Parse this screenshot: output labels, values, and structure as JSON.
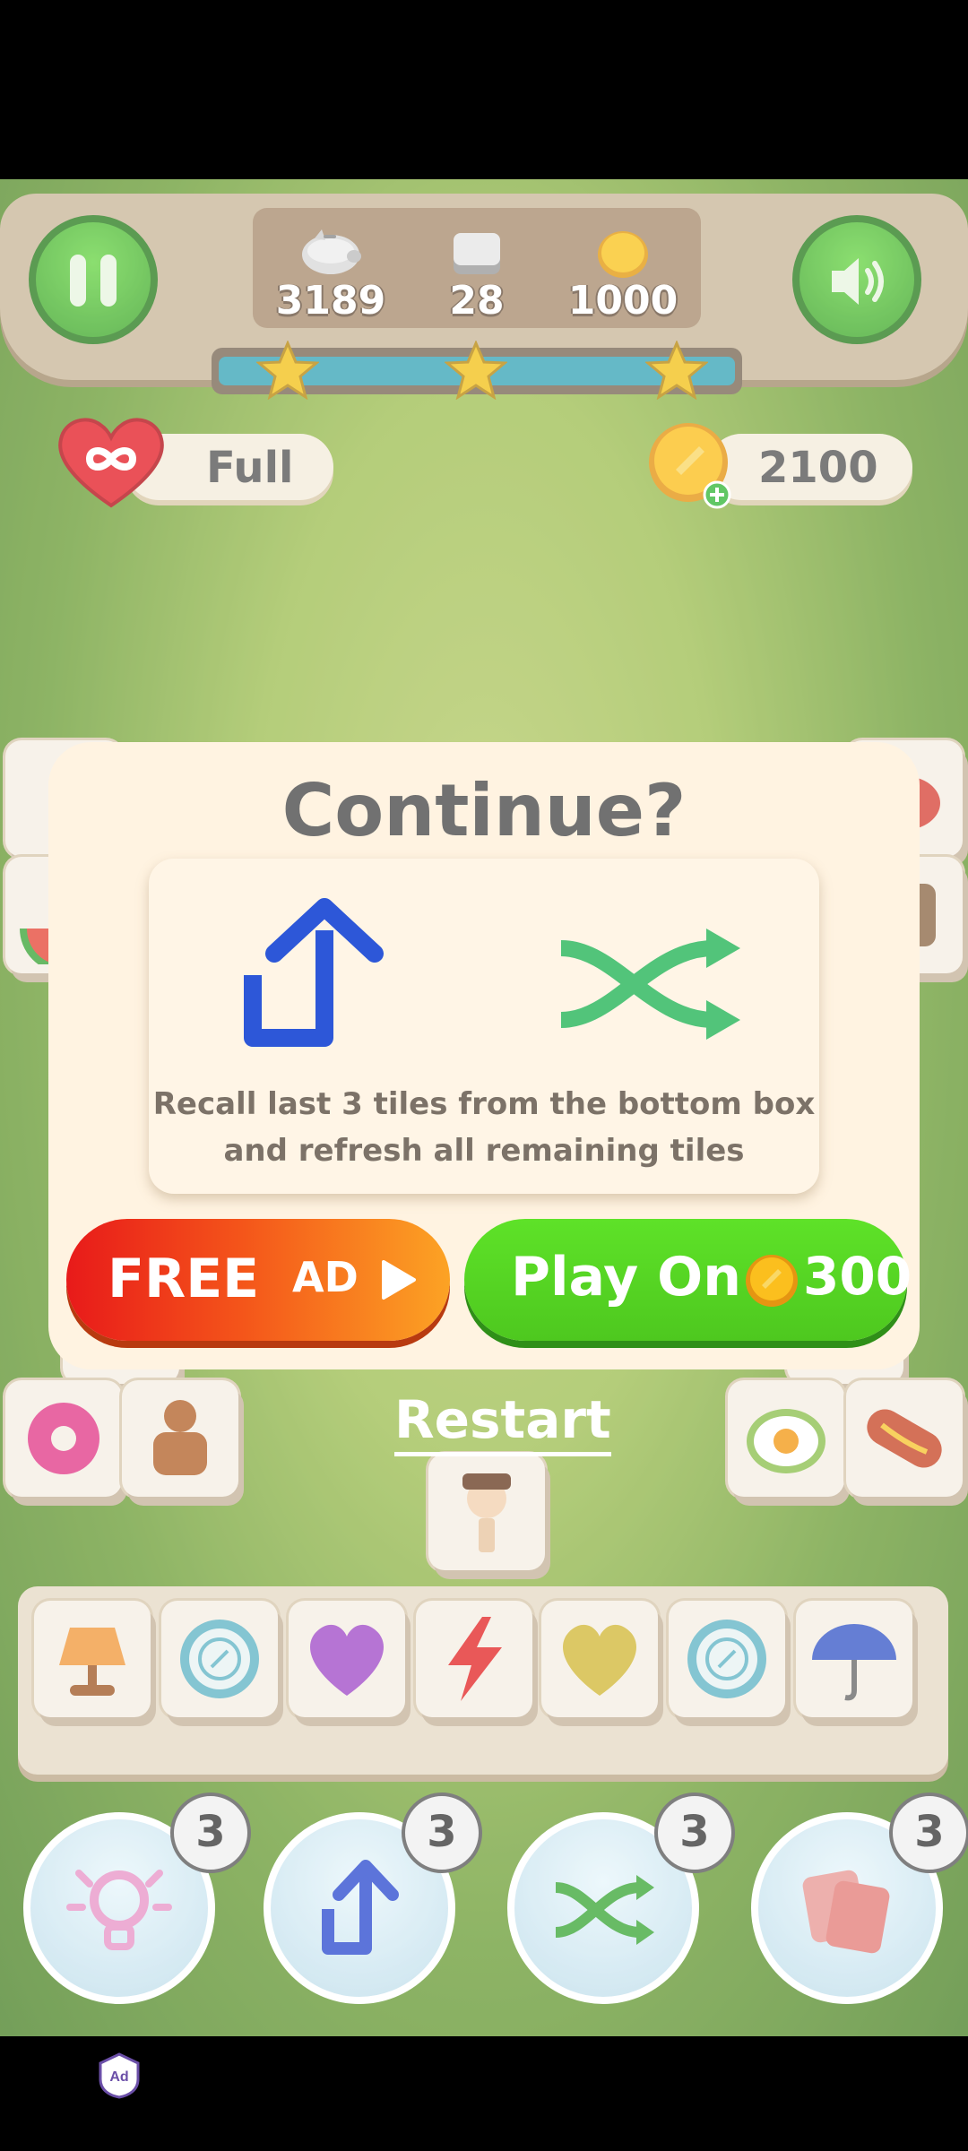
{
  "hud": {
    "stats": [
      {
        "icon": "piggy-bank-icon",
        "value": "3189"
      },
      {
        "icon": "tile-stack-icon",
        "value": "28"
      },
      {
        "icon": "gold-coin-icon",
        "value": "1000"
      }
    ],
    "progress": 1.0,
    "stars": 3
  },
  "lives": {
    "icon": "infinity-heart-icon",
    "label": "Full"
  },
  "coins": {
    "icon": "coin-plus-icon",
    "value": "2100"
  },
  "dialog": {
    "title": "Continue?",
    "description_line1": "Recall last 3 tiles from the bottom box",
    "description_line2": "and refresh all remaining tiles",
    "free_button": {
      "label": "FREE",
      "ad_label": "AD"
    },
    "play_button": {
      "label": "Play On",
      "price": "300"
    }
  },
  "restart_label": "Restart",
  "tray_tiles": [
    "lamp",
    "plate",
    "purple-heart",
    "lightning",
    "yellow-heart",
    "plate",
    "umbrella"
  ],
  "powerups": [
    {
      "name": "hint",
      "count": "3"
    },
    {
      "name": "undo",
      "count": "3"
    },
    {
      "name": "shuffle",
      "count": "3"
    },
    {
      "name": "cards",
      "count": "3"
    }
  ],
  "colors": {
    "play_green": "#4ec81f",
    "free_red": "#e81a1a",
    "free_orange": "#fca324",
    "dialog_bg": "#fff3e1"
  }
}
